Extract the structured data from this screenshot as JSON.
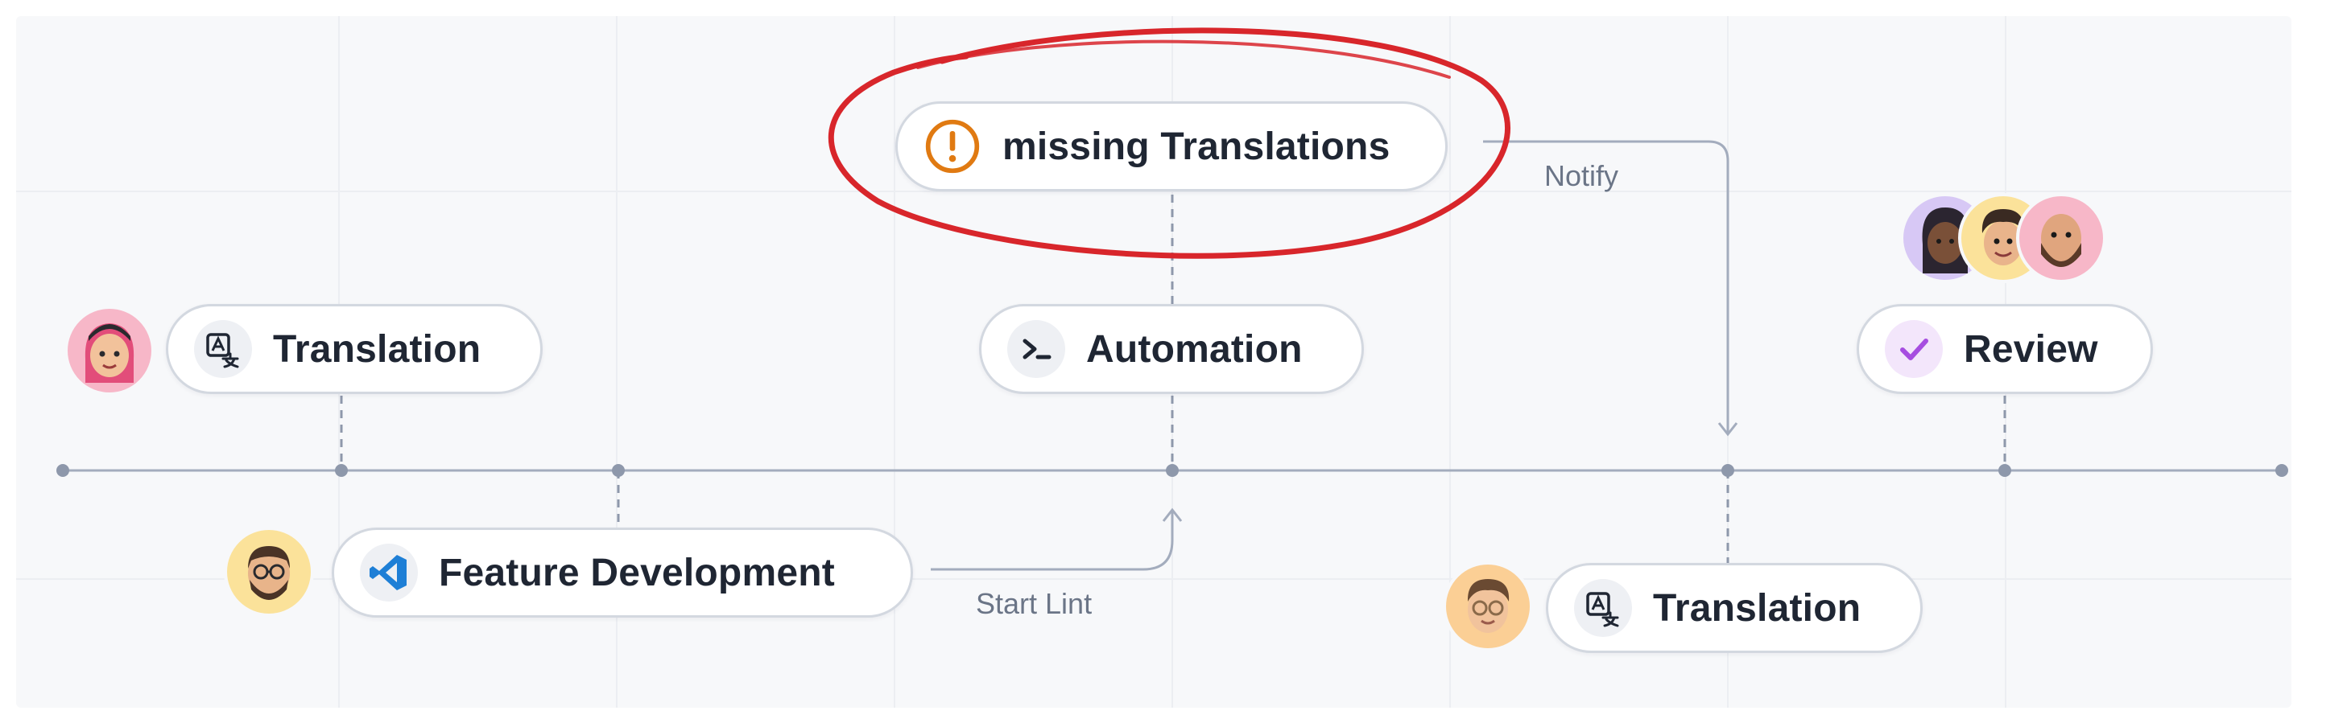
{
  "nodes": {
    "missing_translations": {
      "label": "missing Translations",
      "icon": "warning-icon"
    },
    "automation": {
      "label": "Automation",
      "icon": "terminal-icon"
    },
    "translation_left": {
      "label": "Translation",
      "icon": "translate-icon"
    },
    "feature_development": {
      "label": "Feature Development",
      "icon": "vscode-icon"
    },
    "translation_right": {
      "label": "Translation",
      "icon": "translate-icon"
    },
    "review": {
      "label": "Review",
      "icon": "check-icon"
    }
  },
  "edges": {
    "notify": "Notify",
    "start_lint": "Start Lint"
  },
  "annotation": {
    "shape": "hand-drawn ellipse",
    "color": "#d8262b"
  },
  "colors": {
    "warning": "#e07a12",
    "vscode": "#1e7fd6",
    "review_check": "#a64de0",
    "line": "#a3acbd"
  },
  "avatars": [
    {
      "name": "avatar-woman-pink",
      "bg": "#f7b7c8"
    },
    {
      "name": "avatar-man-glasses-beard",
      "bg": "#fbe29a"
    },
    {
      "name": "avatar-man-glasses",
      "bg": "#fbcf95"
    },
    {
      "name": "avatar-woman-purple",
      "bg": "#d7c8f5"
    },
    {
      "name": "avatar-man-curly",
      "bg": "#fbe29a"
    },
    {
      "name": "avatar-man-bald-beard",
      "bg": "#f7b7c8"
    }
  ]
}
